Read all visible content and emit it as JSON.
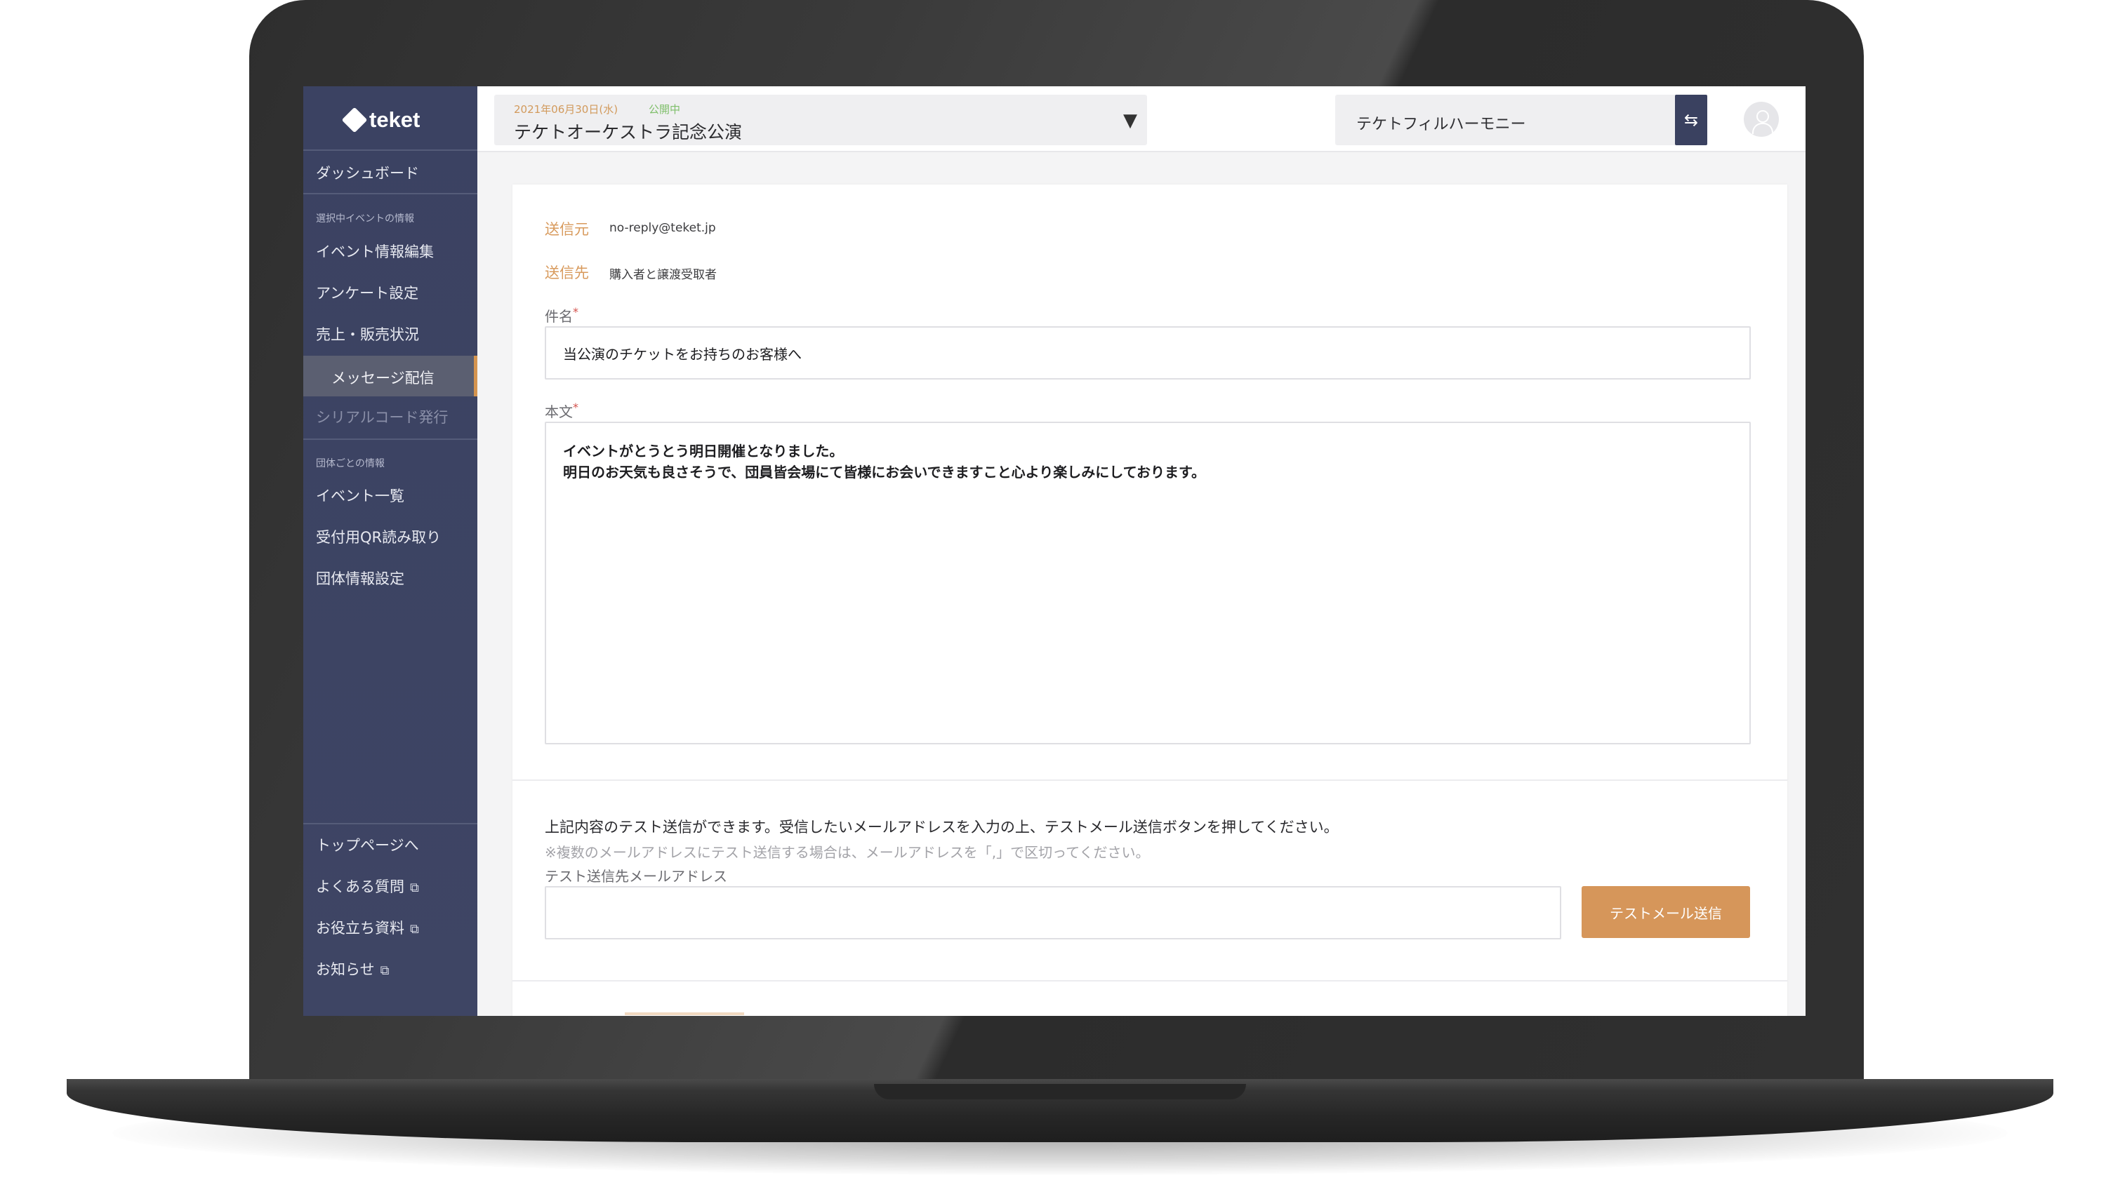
{
  "sidebar": {
    "logo": "teket",
    "dashboard": "ダッシュボード",
    "section_event": "選択中イベントの情報",
    "event_items": [
      "イベント情報編集",
      "アンケート設定",
      "売上・販売状況",
      "メッセージ配信",
      "シリアルコード発行"
    ],
    "section_org": "団体ごとの情報",
    "org_items": [
      "イベント一覧",
      "受付用QR読み取り",
      "団体情報設定"
    ],
    "footer_items": [
      "トップページへ",
      "よくある質問",
      "お役立ち資料",
      "お知らせ"
    ]
  },
  "header": {
    "event_date": "2021年06月30日(水)",
    "event_status": "公開中",
    "event_name": "テケトオーケストラ記念公演",
    "organization": "テケトフィルハーモニー"
  },
  "message": {
    "from_label": "送信元",
    "from_value": "no-reply@teket.jp",
    "to_label": "送信先",
    "to_value": "購入者と譲渡受取者",
    "subject_label": "件名",
    "subject_value": "当公演のチケットをお持ちのお客様へ",
    "body_label": "本文",
    "body_lines": [
      "イベントがとうとう明日開催となりました。",
      "明日のお天気も良さそうで、団員皆会場にて皆様にお会いできますこと心より楽しみにしております。"
    ],
    "required_mark": "*"
  },
  "test_send": {
    "description": "上記内容のテスト送信ができます。受信したいメールアドレスを入力の上、テストメール送信ボタンを押してください。",
    "note": "※複数のメールアドレスにテスト送信する場合は、メールアドレスを「,」で区切ってください。",
    "address_label": "テスト送信先メールアドレス",
    "address_value": "",
    "button_label": "テストメール送信"
  },
  "icons": {
    "caret": "▼",
    "switch": "⇆",
    "external": "⧉"
  },
  "colors": {
    "sidebar_bg": "#3b4262",
    "accent_orange": "#d6965a",
    "status_green": "#7fbf6a"
  }
}
